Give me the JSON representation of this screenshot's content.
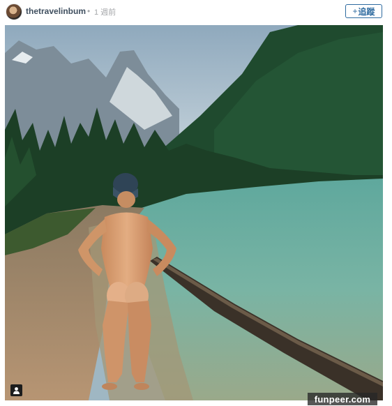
{
  "post": {
    "username": "thetravelinbum",
    "separator": "•",
    "time_ago": "1 週前",
    "follow_icon": "plus",
    "follow_label": "追蹤"
  },
  "photo": {
    "badge_icon": "user-icon"
  },
  "watermark": {
    "text": "funpeer.com"
  }
}
